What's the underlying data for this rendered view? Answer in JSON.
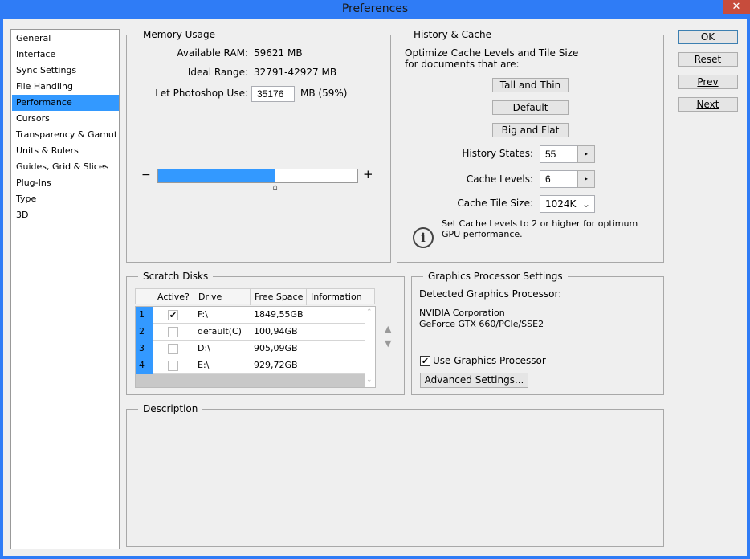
{
  "window": {
    "title": "Preferences",
    "close": "✕"
  },
  "sidebar": {
    "items": [
      {
        "label": "General"
      },
      {
        "label": "Interface"
      },
      {
        "label": "Sync Settings"
      },
      {
        "label": "File Handling"
      },
      {
        "label": "Performance",
        "selected": true
      },
      {
        "label": "Cursors"
      },
      {
        "label": "Transparency & Gamut"
      },
      {
        "label": "Units & Rulers"
      },
      {
        "label": "Guides, Grid & Slices"
      },
      {
        "label": "Plug-Ins"
      },
      {
        "label": "Type"
      },
      {
        "label": "3D"
      }
    ]
  },
  "memory": {
    "title": "Memory Usage",
    "available_label": "Available RAM:",
    "available_value": "59621 MB",
    "ideal_label": "Ideal Range:",
    "ideal_value": "32791-42927 MB",
    "use_label": "Let Photoshop Use:",
    "use_value": "35176",
    "use_unit": "MB (59%)",
    "slider_percent": 59,
    "minus": "−",
    "plus": "+"
  },
  "history": {
    "title": "History & Cache",
    "desc": "Optimize Cache Levels and Tile Size for documents that are:",
    "buttons": [
      "Tall and Thin",
      "Default",
      "Big and Flat"
    ],
    "history_label": "History States:",
    "history_value": "55",
    "cache_label": "Cache Levels:",
    "cache_value": "6",
    "tile_label": "Cache Tile Size:",
    "tile_value": "1024K",
    "info": "Set Cache Levels to 2 or higher for optimum GPU performance."
  },
  "actions": {
    "ok": "OK",
    "reset": "Reset",
    "prev": "Prev",
    "next": "Next"
  },
  "scratch": {
    "title": "Scratch Disks",
    "columns": [
      "Active?",
      "Drive",
      "Free Space",
      "Information"
    ],
    "rows": [
      {
        "n": "1",
        "active": true,
        "drive": "F:\\",
        "free": "1849,55GB"
      },
      {
        "n": "2",
        "active": false,
        "drive": "default(C)",
        "free": "100,94GB"
      },
      {
        "n": "3",
        "active": false,
        "drive": "D:\\",
        "free": "905,09GB"
      },
      {
        "n": "4",
        "active": false,
        "drive": "E:\\",
        "free": "929,72GB"
      }
    ]
  },
  "gpu": {
    "title": "Graphics Processor Settings",
    "detected_label": "Detected Graphics Processor:",
    "vendor": "NVIDIA Corporation",
    "model": "GeForce GTX 660/PCIe/SSE2",
    "use_label": "Use Graphics Processor",
    "use_checked": true,
    "advanced": "Advanced Settings..."
  },
  "description": {
    "title": "Description"
  },
  "colors": {
    "accent": "#3399ff",
    "titlebar": "#2f7cf6",
    "close": "#c74c3c"
  }
}
